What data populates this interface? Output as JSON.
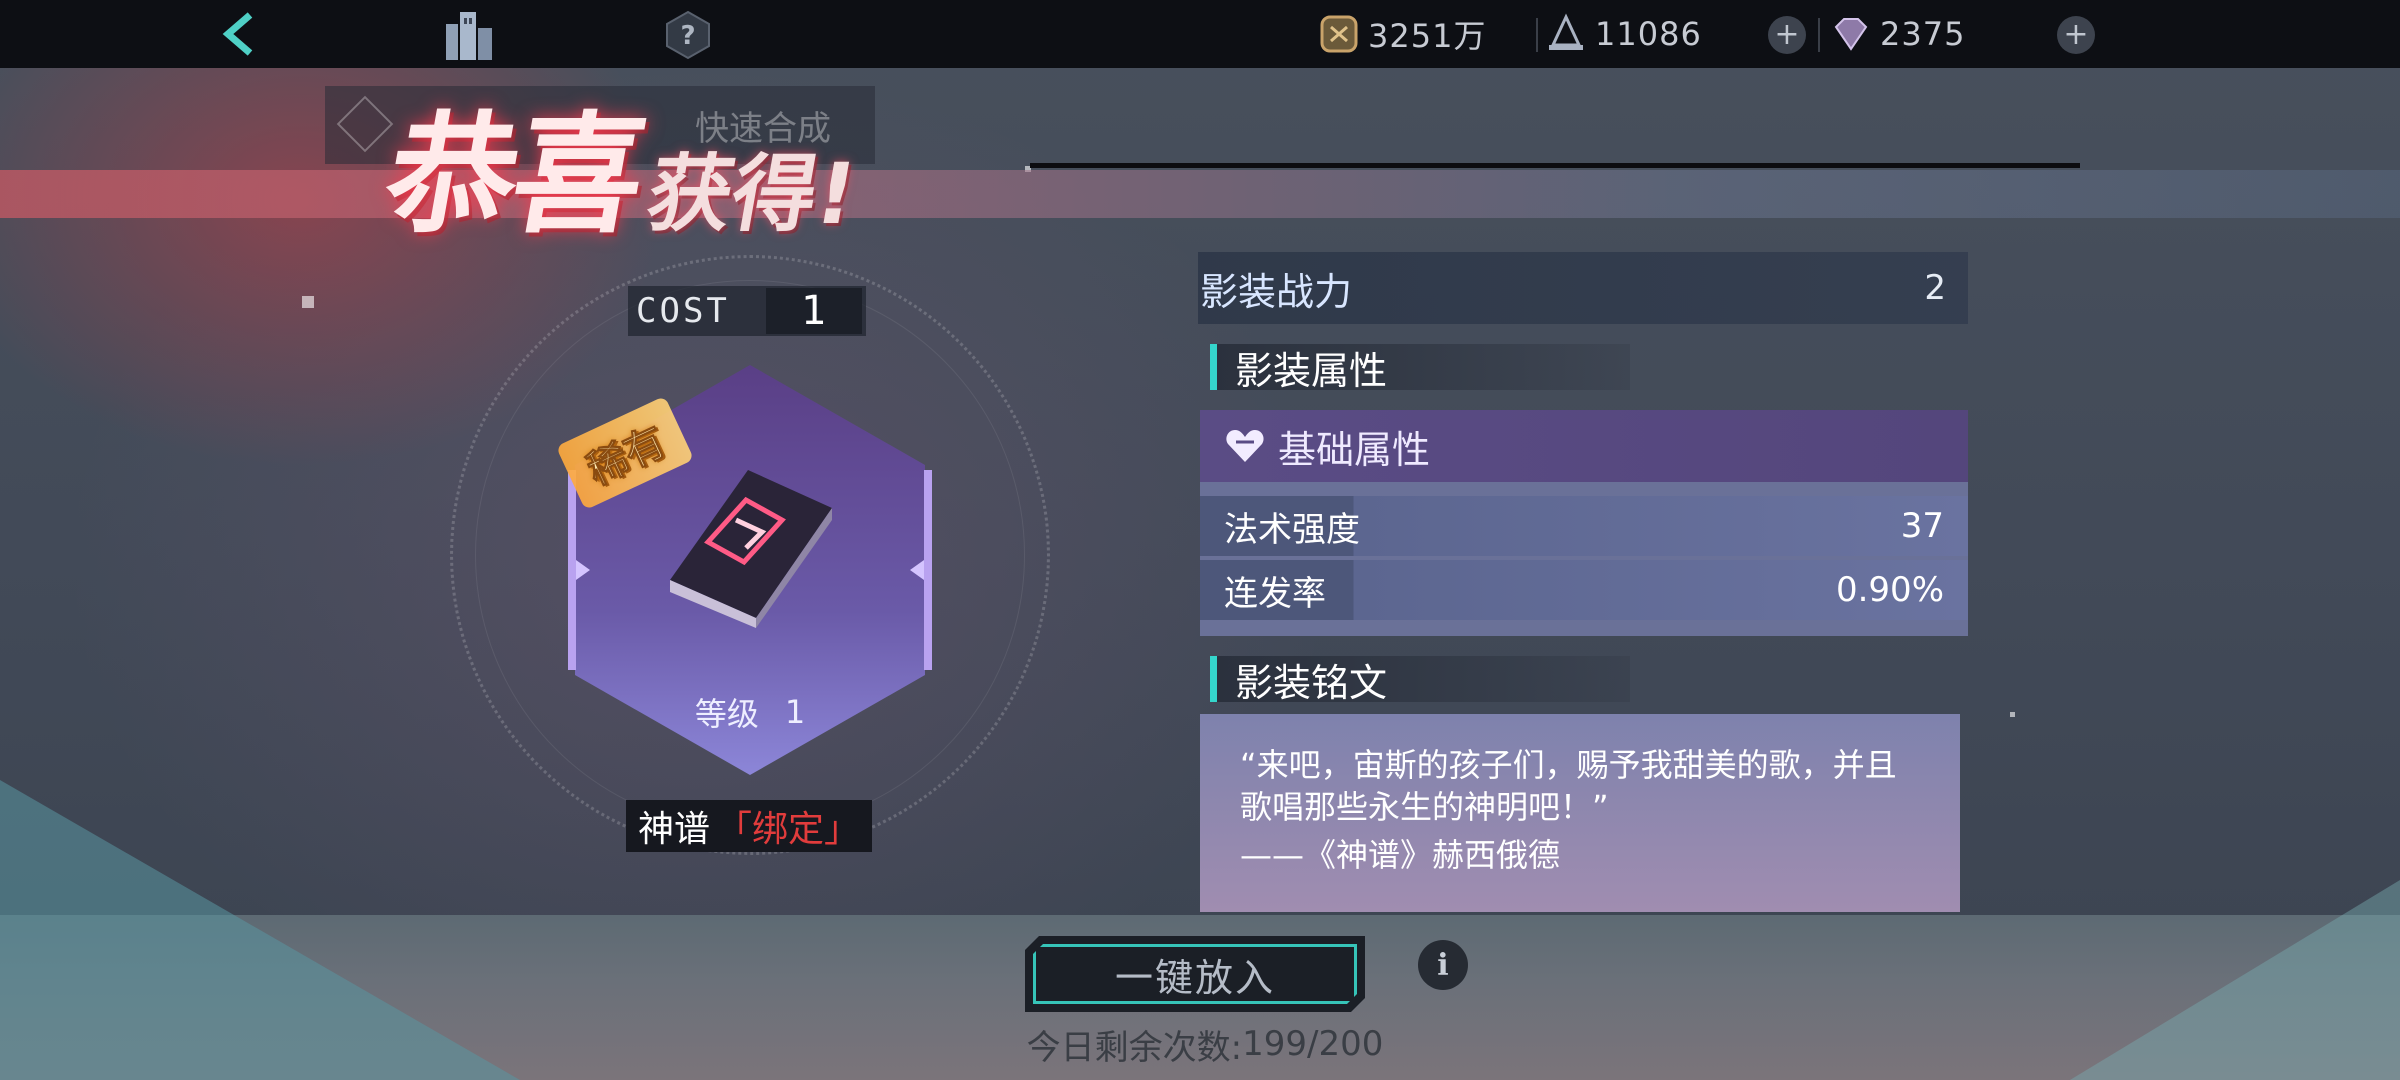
{
  "topbar": {
    "icons": [
      "back-icon",
      "building-icon",
      "help-icon"
    ],
    "resources": [
      {
        "icon": "coin-icon",
        "value": "3251万"
      },
      {
        "icon": "ship-icon",
        "value": "11086"
      },
      {
        "icon": "diamond-icon",
        "value": "2375"
      }
    ],
    "plus": "+"
  },
  "background_tab": {
    "label": "快速合成"
  },
  "banner": {
    "title_main": "恭喜",
    "title_sub": "获得!"
  },
  "item": {
    "cost_label": "COST",
    "cost_value": "1",
    "rarity": "稀有",
    "level_label": "等级",
    "level_value": "1",
    "name": "神谱",
    "bind_tag": "「绑定」",
    "accent": "#e13c3c"
  },
  "stats": {
    "power_label": "影装战力",
    "power_value": "2",
    "attributes_title": "影装属性",
    "base_title": "基础属性",
    "rows": [
      {
        "label": "法术强度",
        "value": "37"
      },
      {
        "label": "连发率",
        "value": "0.90%"
      }
    ],
    "inscription_title": "影装铭文",
    "quote_line1": "“来吧，宙斯的孩子们，赐予我甜美的歌，并且歌唱那些永生的神明吧！”",
    "quote_line2": "——《神谱》赫西俄德"
  },
  "footer": {
    "action_label": "一键放入",
    "remaining_label": "今日剩余次数:",
    "remaining_value": "199/200"
  },
  "colors": {
    "teal_accent": "#35d6cc",
    "purple_panel": "#5a4c85"
  }
}
